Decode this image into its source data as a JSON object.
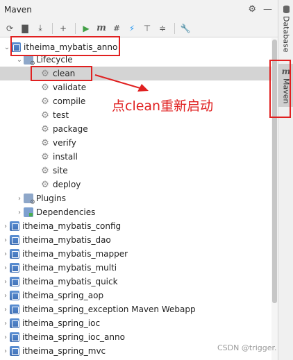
{
  "panel": {
    "title": "Maven"
  },
  "titlebar_actions": [
    "gear-icon",
    "minimize-icon"
  ],
  "toolbar": {
    "icons": [
      "reload-icon",
      "add-maven-project-icon",
      "download-icon",
      "plus-icon",
      "run-icon",
      "execute-goal-icon",
      "toggle-offline-icon",
      "skip-tests-icon",
      "show-dependencies-icon",
      "collapse-all-icon",
      "settings-wrench-icon"
    ]
  },
  "tree": {
    "root": "itheima_mybatis_anno",
    "lifecycle": "Lifecycle",
    "goals": [
      "clean",
      "validate",
      "compile",
      "test",
      "package",
      "verify",
      "install",
      "site",
      "deploy"
    ],
    "plugins": "Plugins",
    "dependencies": "Dependencies",
    "modules": [
      "itheima_mybatis_config",
      "itheima_mybatis_dao",
      "itheima_mybatis_mapper",
      "itheima_mybatis_multi",
      "itheima_mybatis_quick",
      "itheima_spring_aop",
      "itheima_spring_exception Maven Webapp",
      "itheima_spring_ioc",
      "itheima_spring_ioc_anno",
      "itheima_spring_mvc"
    ]
  },
  "sidebar": {
    "database": "Database",
    "maven": "Maven"
  },
  "annotation": {
    "text": "点clean重新启动",
    "color": "#e02020"
  },
  "watermark": "CSDN @trigger."
}
